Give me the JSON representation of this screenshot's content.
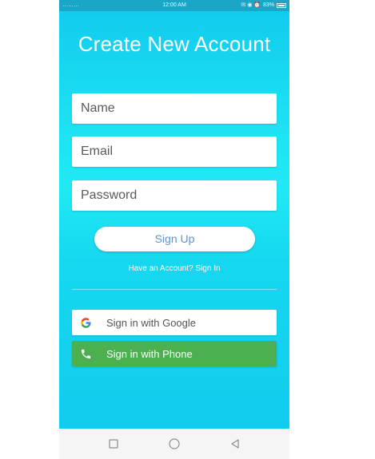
{
  "status_bar": {
    "signal": "………",
    "time": "12:00 AM",
    "icons": "✉ ◉ ⏰",
    "battery_percent": "83%",
    "battery_level": 0.83
  },
  "title": "Create New Account",
  "form": {
    "name_placeholder": "Name",
    "email_placeholder": "Email",
    "password_placeholder": "Password"
  },
  "signup_button_label": "Sign Up",
  "have_account_text": "Have an Account? Sign In",
  "google_button": {
    "label": "Sign in with Google",
    "icon": "google-icon"
  },
  "phone_button": {
    "label": "Sign in with Phone",
    "icon": "phone-icon"
  },
  "nav_bar": {
    "recent_icon": "square-icon",
    "home_icon": "circle-icon",
    "back_icon": "triangle-back-icon"
  },
  "colors": {
    "status_bar": "#1aa7c7",
    "screen_gradient_top": "#12ccee",
    "screen_gradient_mid": "#20e9f4",
    "signup_text": "#5b94d6",
    "phone_button": "#4caf50",
    "nav_bar": "#f5f5f5"
  }
}
